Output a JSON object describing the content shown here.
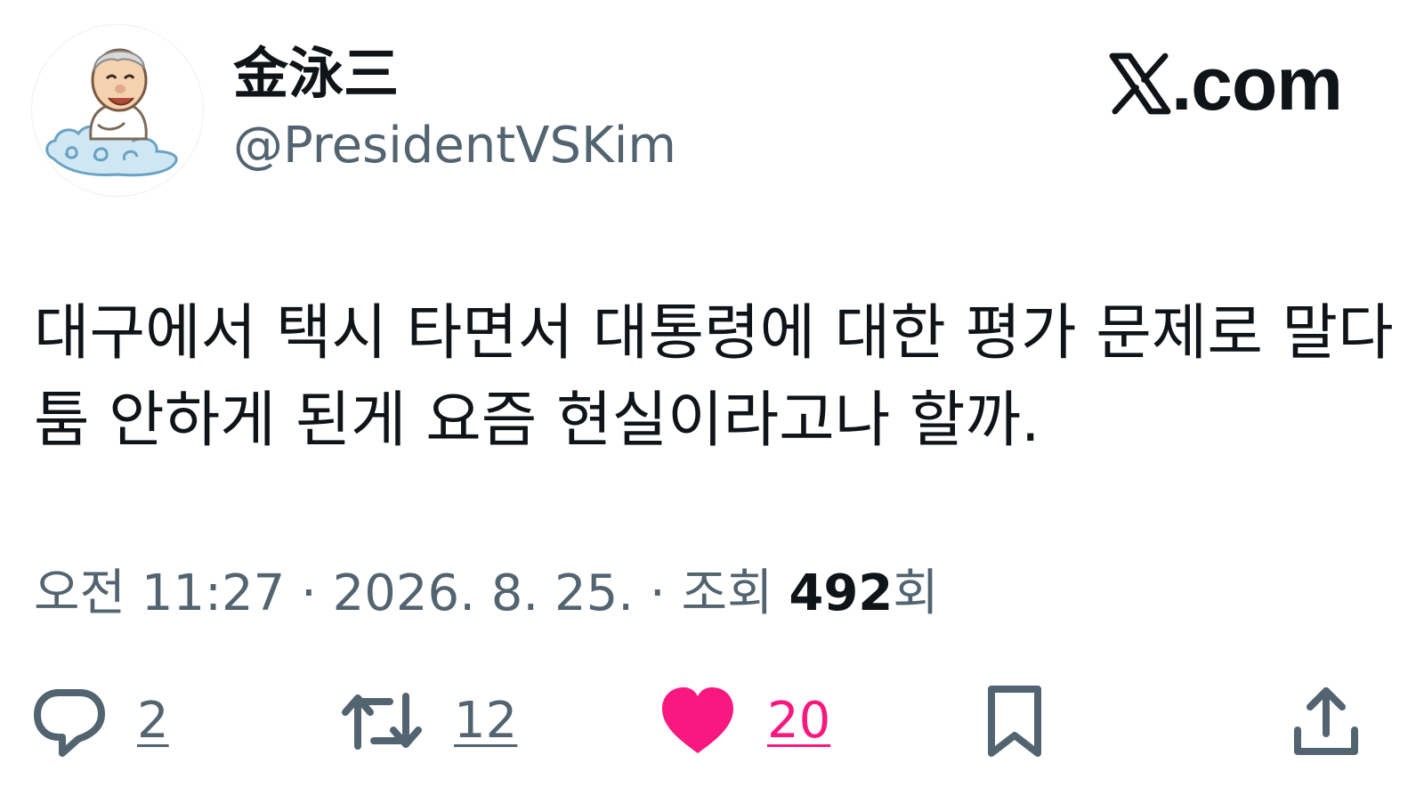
{
  "author": {
    "display_name": "金泳三",
    "handle": "@PresidentVSKim",
    "avatar_icon": "cartoon-man-on-cloud-avatar"
  },
  "brand": {
    "icon": "x-logo-icon",
    "text": ".com"
  },
  "tweet": {
    "lines": [
      "대구에서 택시 타면서 대통령에 대한 평가 문제로 말다",
      "툼 안하게 된게 요즘 현실이라고나 할까."
    ]
  },
  "meta": {
    "time": "오전 11:27",
    "separator": "·",
    "date": "2026. 8. 25.",
    "views_label": "조회",
    "views_count": "492",
    "views_suffix": "회"
  },
  "actions": {
    "reply": {
      "icon": "reply-bubble-icon",
      "count": "2"
    },
    "retweet": {
      "icon": "retweet-icon",
      "count": "12"
    },
    "like": {
      "icon": "heart-filled-icon",
      "count": "20"
    },
    "bookmark": {
      "icon": "bookmark-icon"
    },
    "share": {
      "icon": "share-upload-icon"
    }
  },
  "colors": {
    "text_primary": "#0f1419",
    "text_secondary": "#536471",
    "like_pink": "#f91880",
    "background": "#ffffff"
  }
}
